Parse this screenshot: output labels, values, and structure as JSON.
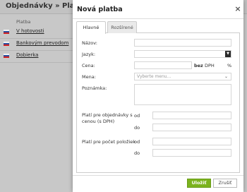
{
  "background": {
    "title": "Objednávky » Platby",
    "column_header": "Platba",
    "rows": [
      "V hotovosti",
      "Bankovým prevodom",
      "Dobierka"
    ]
  },
  "modal": {
    "title": "Nová platba",
    "close_label": "×",
    "tabs": [
      "Hlavné",
      "Rozšírené"
    ],
    "form": {
      "name_label": "Názov:",
      "language_label": "Jazyk:",
      "price_label": "Cena:",
      "price_bez": "bez",
      "price_dph": "DPH",
      "percent": "%",
      "currency_label": "Mena:",
      "currency_placeholder": "Vyberte menu...",
      "note_label": "Poznámka:",
      "order_price_label_line1": "Platí pre objednávky s",
      "order_price_label_line2": "cenou (s DPH)",
      "from_label": "od",
      "to_label": "do",
      "items_label": "Platí pre počet položiek",
      "items_from_label": "od",
      "items_to_label": "do"
    },
    "buttons": {
      "save": "Uložiť",
      "cancel": "Zrušiť"
    }
  },
  "colors": {
    "save_button": "#7bb31e",
    "overlay": "#c4c4c4"
  },
  "icons": {
    "close": "close-icon",
    "dropdown": "chevron-down-icon",
    "flag": "slovak-flag-icon"
  }
}
